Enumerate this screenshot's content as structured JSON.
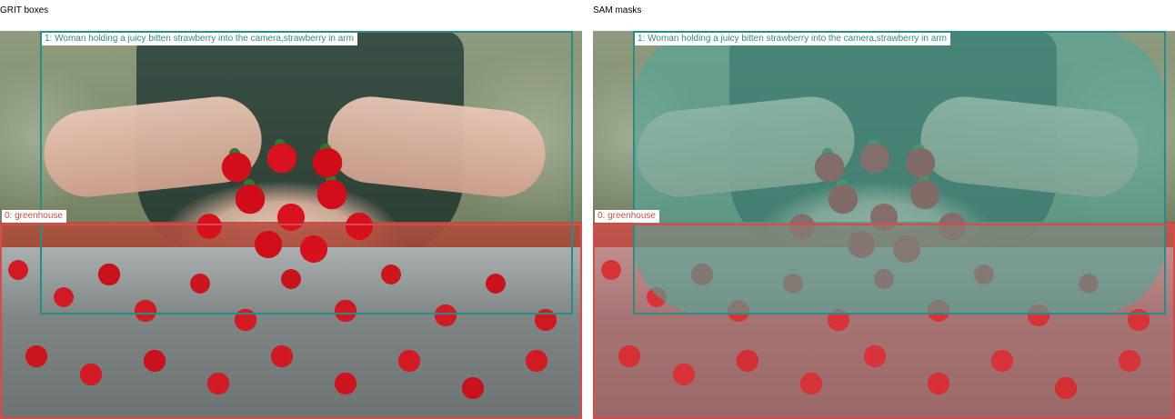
{
  "panels": [
    {
      "id": "left",
      "title": "GRIT boxes",
      "mode": "boxes"
    },
    {
      "id": "right",
      "title": "SAM masks",
      "mode": "masks"
    }
  ],
  "colors": {
    "teal": "#2a8c86",
    "red": "#d84b4b",
    "teal_mask": "rgba(80, 166, 151, 0.62)",
    "red_mask": "rgba(224, 91, 91, 0.40)"
  },
  "annotations": [
    {
      "id": "1",
      "label": "1: Woman holding a juicy bitten strawberry into the camera,strawberry in arm",
      "color_key": "teal"
    },
    {
      "id": "0",
      "label": "0: greenhouse",
      "color_key": "red"
    }
  ]
}
